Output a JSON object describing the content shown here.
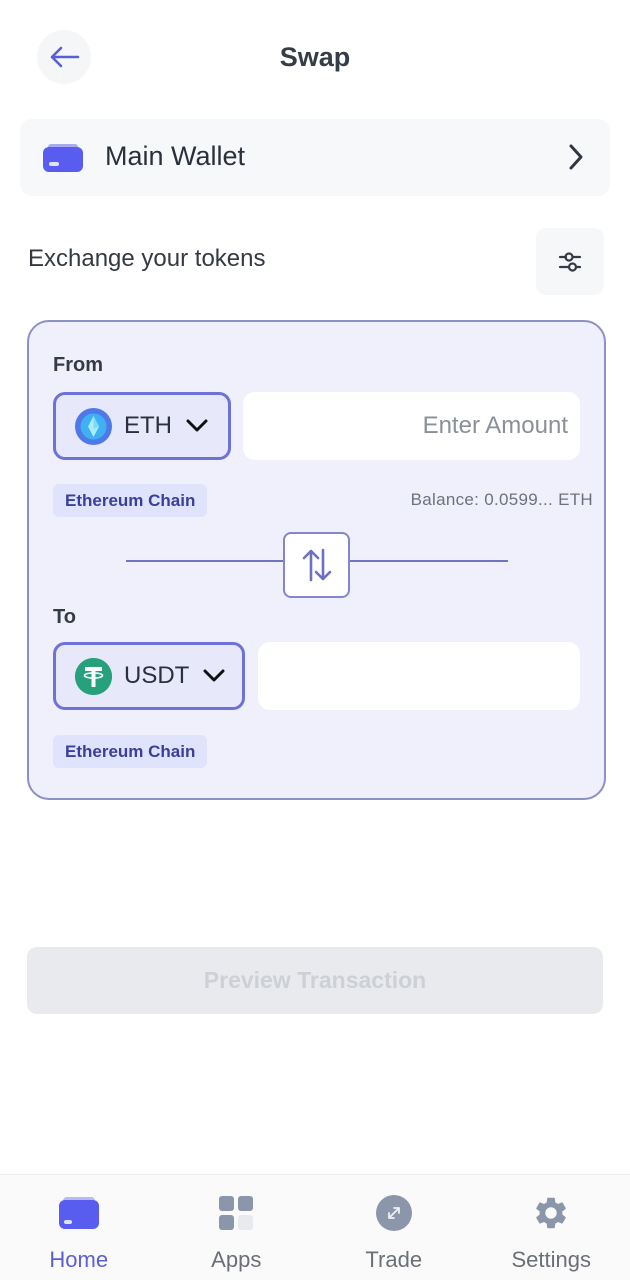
{
  "header": {
    "title": "Swap",
    "back_icon": "arrow-left-icon"
  },
  "wallet": {
    "label": "Main Wallet",
    "icon": "wallet-icon",
    "chevron_icon": "chevron-right-icon"
  },
  "exchange": {
    "title": "Exchange your tokens",
    "settings_icon": "sliders-icon"
  },
  "from": {
    "label": "From",
    "token": "ETH",
    "token_icon": "ethereum-icon",
    "amount_value": "",
    "amount_placeholder": "Enter Amount",
    "chain": "Ethereum Chain",
    "balance": "Balance: 0.0599... ETH"
  },
  "swap_toggle": {
    "icon": "swap-vertical-icon"
  },
  "to": {
    "label": "To",
    "token": "USDT",
    "token_icon": "tether-icon",
    "amount_value": "",
    "amount_placeholder": "",
    "chain": "Ethereum Chain"
  },
  "actions": {
    "preview_label": "Preview Transaction",
    "preview_enabled": false
  },
  "nav": {
    "items": [
      {
        "label": "Home",
        "icon": "wallet-icon",
        "active": true
      },
      {
        "label": "Apps",
        "icon": "grid-icon",
        "active": false
      },
      {
        "label": "Trade",
        "icon": "trade-icon",
        "active": false
      },
      {
        "label": "Settings",
        "icon": "gear-icon",
        "active": false
      }
    ]
  },
  "colors": {
    "accent": "#5b5fd6",
    "card_bg": "#eff0fc",
    "card_border": "#8e8fc4",
    "chain_badge_text": "#3a3f9a",
    "eth_blue": "#3e8ff0",
    "usdt_green": "#26a17b",
    "disabled_button": "#e9eaee"
  }
}
